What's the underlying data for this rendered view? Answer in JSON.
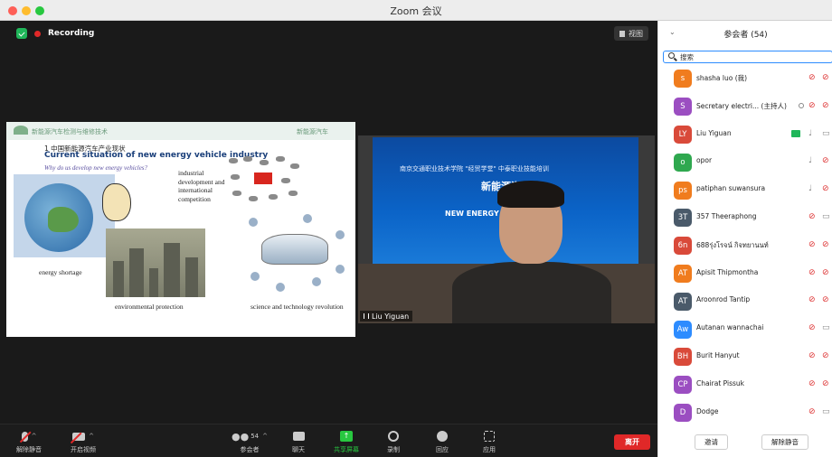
{
  "window": {
    "title": "Zoom 会议"
  },
  "meeting": {
    "recording_label": "Recording",
    "view_label": "视图"
  },
  "slide": {
    "header_left": "新能源汽车检测与维修技术",
    "header_right": "新能源汽车",
    "section_num": "1",
    "title_cn": "1 中国新能源汽车产业现状",
    "title_en": "Current situation of new energy vehicle industry",
    "question": "Why do us develop new energy vehicles?",
    "label_industrial": "industrial development and international competition",
    "label_energy": "energy shortage",
    "label_env": "environmental protection",
    "label_science": "science and technology revolution"
  },
  "video": {
    "speaker_name": "Liu Yiguan",
    "screen_line1": "南京交通职业技术学院 \"经贸学堂\" 中泰职业技能培训",
    "screen_line2": "新能源汽",
    "screen_line3": "NEW ENERGY VE"
  },
  "toolbar": {
    "unmute": "解除静音",
    "start_video": "开启视频",
    "participants": "参会者",
    "participants_count": "54",
    "chat": "聊天",
    "share": "共享屏幕",
    "record": "录制",
    "reactions": "回应",
    "apps": "应用",
    "leave": "离开"
  },
  "panel": {
    "title": "参会者 (54)",
    "search_placeholder": "搜索",
    "invite": "邀请",
    "unmute_me": "解除静音",
    "participants": [
      {
        "initials": "s",
        "name": "shasha luo (我)",
        "color": "#f07c1e",
        "mic": "muted",
        "cam": "off"
      },
      {
        "initials": "S",
        "name": "Secretary electri... (主持人)",
        "color": "#9b4ec1",
        "mic": "muted",
        "cam": "off",
        "host": true
      },
      {
        "initials": "LY",
        "name": "Liu Yiguan",
        "color": "#d94a3a",
        "mic": "on",
        "cam": "on",
        "sharing": true
      },
      {
        "initials": "o",
        "name": "opor",
        "color": "#2fa84f",
        "mic": "on",
        "cam": "off"
      },
      {
        "initials": "ps",
        "name": "patiphan suwansura",
        "color": "#f07c1e",
        "mic": "on",
        "cam": "off"
      },
      {
        "initials": "3T",
        "name": "357 Theeraphong",
        "color": "#4a5a6a",
        "mic": "muted",
        "cam": "on"
      },
      {
        "initials": "6n",
        "name": "688รุ่งโรจน์ กิจทยานนท์",
        "color": "#d94a3a",
        "mic": "muted",
        "cam": "off"
      },
      {
        "initials": "AT",
        "name": "Apisit Thipmontha",
        "color": "#f07c1e",
        "mic": "muted",
        "cam": "off"
      },
      {
        "initials": "AT",
        "name": "Aroonrod Tantip",
        "color": "#4a5a6a",
        "mic": "muted",
        "cam": "off"
      },
      {
        "initials": "Aw",
        "name": "Autanan wannachai",
        "color": "#2d8cff",
        "mic": "muted",
        "cam": "on"
      },
      {
        "initials": "BH",
        "name": "Burit Hanyut",
        "color": "#d94a3a",
        "mic": "muted",
        "cam": "off"
      },
      {
        "initials": "CP",
        "name": "Chairat Pissuk",
        "color": "#9b4ec1",
        "mic": "muted",
        "cam": "off"
      },
      {
        "initials": "D",
        "name": "Dodge",
        "color": "#9b4ec1",
        "mic": "muted",
        "cam": "on"
      }
    ]
  }
}
